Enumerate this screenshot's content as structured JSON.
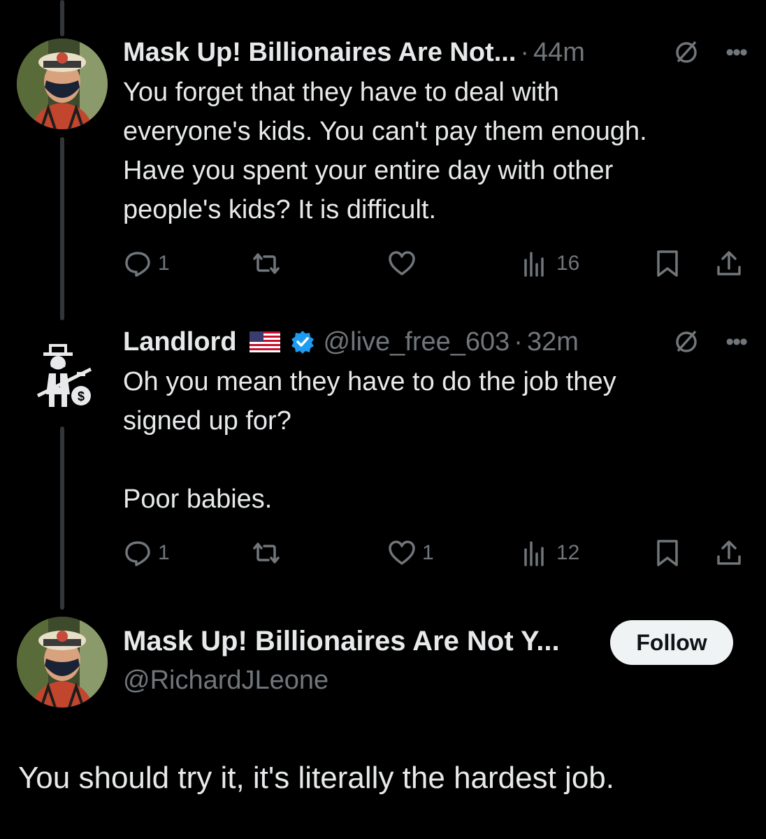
{
  "reply1": {
    "display_name": "Mask Up! Billionaires Are Not...",
    "time": "44m",
    "text_lines": [
      "You forget that they have to deal with",
      "everyone's kids. You can't pay them enough.",
      "Have you spent your entire day with other",
      "people's kids? It is difficult."
    ],
    "replies": "1",
    "reposts": "",
    "likes": "",
    "views": "16",
    "avatar_icon": "masked-man-avatar"
  },
  "reply2": {
    "display_name": "Landlord",
    "handle": "@live_free_603",
    "time": "32m",
    "text_lines": [
      "Oh you mean they have to do the job they",
      "signed up for?",
      "",
      "Poor babies."
    ],
    "replies": "1",
    "reposts": "",
    "likes": "1",
    "views": "12",
    "avatar_icon": "monopoly-man-avatar"
  },
  "main": {
    "display_name": "Mask Up! Billionaires Are Not Y...",
    "handle": "@RichardJLeone",
    "follow_label": "Follow",
    "text": "You should try it, it's literally the hardest job."
  },
  "separator": "·",
  "colors": {
    "background": "#000000",
    "text": "#e7e9ea",
    "muted": "#71767b",
    "verified": "#1d9bf0",
    "follow_bg": "#eff3f4"
  }
}
